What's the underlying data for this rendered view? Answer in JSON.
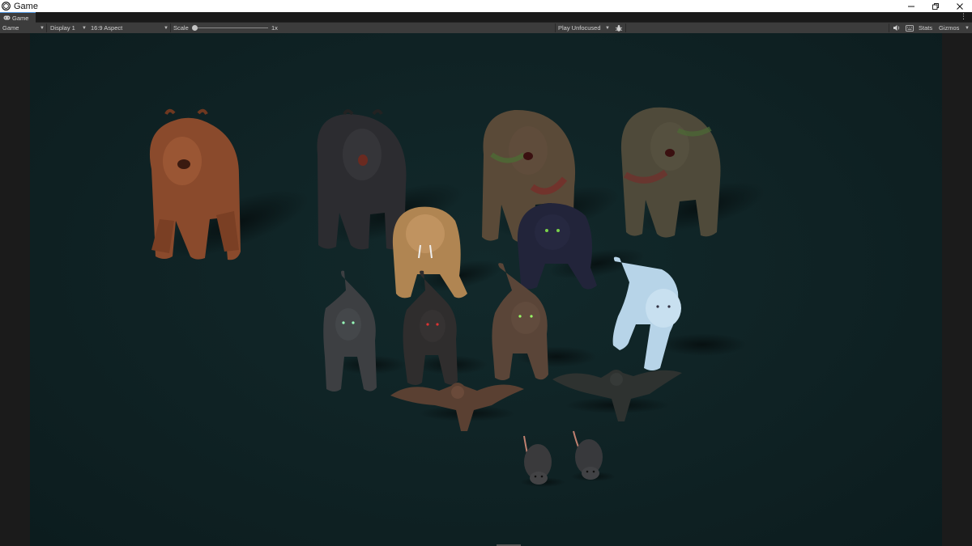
{
  "window": {
    "title": "Game",
    "icon": "unity-logo-icon",
    "controls": [
      "minimize-icon",
      "restore-icon",
      "close-icon"
    ]
  },
  "tab": {
    "label": "Game",
    "icon": "gamepad-icon"
  },
  "toolbar": {
    "view_mode": "Game",
    "display": "Display 1",
    "aspect": "16:9 Aspect",
    "scale_label": "Scale",
    "scale_value": "1x",
    "scale_fraction": 0.0,
    "play_mode": "Play Unfocused",
    "debug_icon": "bug-icon",
    "audio_icon": "speaker-icon",
    "keyboard_icon": "keyboard-icon",
    "stats_label": "Stats",
    "gizmos_label": "Gizmos"
  },
  "scene": {
    "background_color": "#0f2224",
    "creatures": [
      {
        "type": "bear",
        "variant": "brown",
        "color": "#8a4a2c"
      },
      {
        "type": "bear",
        "variant": "black",
        "color": "#2c2c30"
      },
      {
        "type": "bear",
        "variant": "zombie",
        "color": "#5a4a38"
      },
      {
        "type": "bear",
        "variant": "zombie",
        "color": "#4f4a3a"
      },
      {
        "type": "sabertooth",
        "variant": "tan",
        "color": "#b08552"
      },
      {
        "type": "panther",
        "variant": "dark",
        "color": "#22243a"
      },
      {
        "type": "wolf",
        "variant": "grey",
        "color": "#3d3f42"
      },
      {
        "type": "wolf",
        "variant": "dark",
        "color": "#2f2d2d"
      },
      {
        "type": "wolf",
        "variant": "brown",
        "color": "#5a4538"
      },
      {
        "type": "wolf",
        "variant": "ice",
        "color": "#b7d4e8"
      },
      {
        "type": "bat",
        "variant": "brown",
        "color": "#5a4032"
      },
      {
        "type": "bat",
        "variant": "dark",
        "color": "#2e3230"
      },
      {
        "type": "rat",
        "variant": "grey",
        "color": "#3a3a3c"
      },
      {
        "type": "rat",
        "variant": "grey",
        "color": "#38393c"
      }
    ]
  }
}
